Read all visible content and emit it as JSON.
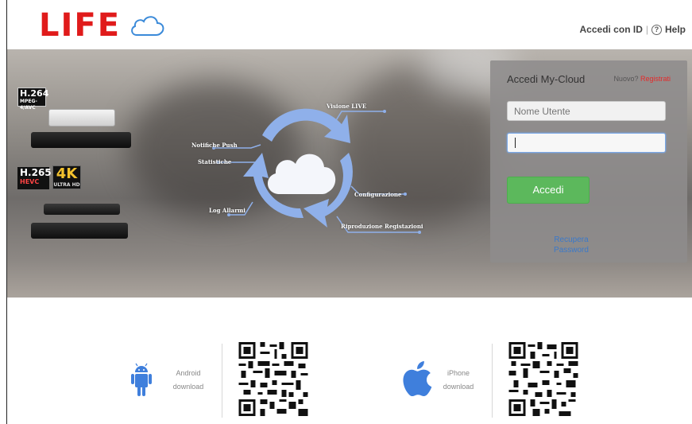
{
  "header": {
    "logo_text": "LIFE",
    "login_link": "Accedi con ID",
    "separator": "|",
    "help_link": "Help",
    "help_icon_glyph": "?"
  },
  "banner": {
    "badges": {
      "h264_main": "H.264",
      "h264_sub": "MPEG-4/AVC",
      "h265_main": "H.265",
      "h265_sub": "HEVC",
      "uhd_main": "4K",
      "uhd_sub": "ULTRA HD"
    },
    "features": {
      "live": "Visione LIVE",
      "push": "Notifiche Push",
      "stats": "Statistiche",
      "alarms": "Log Allarmi",
      "config": "Configurazione",
      "playback": "Riproduzione Registazioni"
    }
  },
  "login": {
    "title": "Accedi My-Cloud",
    "new_prefix": "Nuovo?",
    "register_link": "Registrati",
    "username_placeholder": "Nome Utente",
    "password_value": "",
    "submit_label": "Accedi",
    "recover_link": "Recupera Password"
  },
  "downloads": {
    "android_label": "Android download",
    "iphone_label": "iPhone download"
  },
  "colors": {
    "brand_red": "#e01b1b",
    "accent_green": "#5cb85c",
    "cloud_blue": "#8fb0ea",
    "android_blue": "#3f7fdc"
  }
}
